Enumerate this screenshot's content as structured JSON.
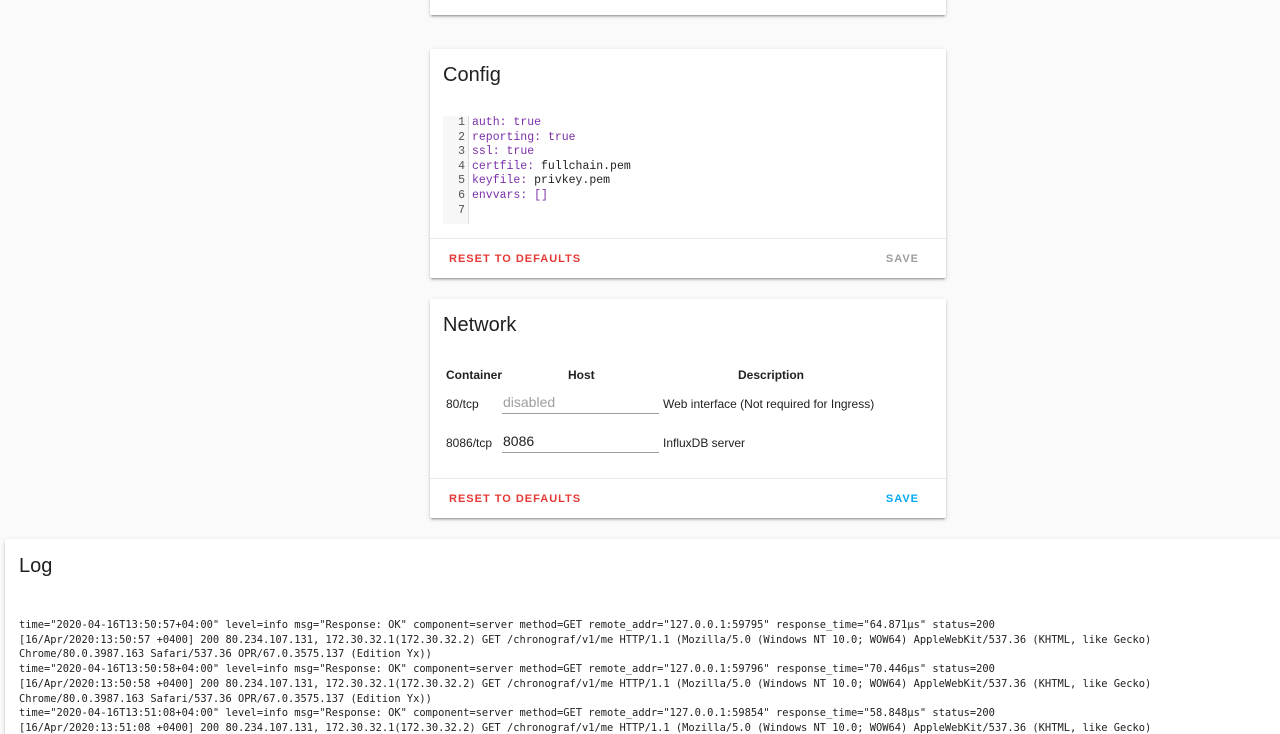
{
  "config": {
    "title": "Config",
    "line_numbers": [
      "1",
      "2",
      "3",
      "4",
      "5",
      "6",
      "7"
    ],
    "lines": [
      {
        "key": "auth",
        "value": "true",
        "bool": true
      },
      {
        "key": "reporting",
        "value": "true",
        "bool": true
      },
      {
        "key": "ssl",
        "value": "true",
        "bool": true
      },
      {
        "key": "certfile",
        "value": "fullchain.pem",
        "bool": false
      },
      {
        "key": "keyfile",
        "value": "privkey.pem",
        "bool": false
      },
      {
        "key": "envvars",
        "value": "[]",
        "bool": true
      },
      {
        "key": "",
        "value": "",
        "bool": false
      }
    ],
    "reset_label": "RESET TO DEFAULTS",
    "save_label": "SAVE"
  },
  "network": {
    "title": "Network",
    "headers": {
      "container": "Container",
      "host": "Host",
      "description": "Description"
    },
    "rows": [
      {
        "container": "80/tcp",
        "host_value": "",
        "host_placeholder": "disabled",
        "description": "Web interface (Not required for Ingress)"
      },
      {
        "container": "8086/tcp",
        "host_value": "8086",
        "host_placeholder": "",
        "description": "InfluxDB server"
      }
    ],
    "reset_label": "RESET TO DEFAULTS",
    "save_label": "SAVE"
  },
  "log": {
    "title": "Log",
    "lines": [
      "time=\"2020-04-16T13:50:57+04:00\" level=info msg=\"Response: OK\" component=server method=GET remote_addr=\"127.0.0.1:59795\" response_time=\"64.871µs\" status=200",
      "[16/Apr/2020:13:50:57 +0400] 200 80.234.107.131, 172.30.32.1(172.30.32.2) GET /chronograf/v1/me HTTP/1.1 (Mozilla/5.0 (Windows NT 10.0; WOW64) AppleWebKit/537.36 (KHTML, like Gecko)",
      "Chrome/80.0.3987.163 Safari/537.36 OPR/67.0.3575.137 (Edition Yx))",
      "time=\"2020-04-16T13:50:58+04:00\" level=info msg=\"Response: OK\" component=server method=GET remote_addr=\"127.0.0.1:59796\" response_time=\"70.446µs\" status=200",
      "[16/Apr/2020:13:50:58 +0400] 200 80.234.107.131, 172.30.32.1(172.30.32.2) GET /chronograf/v1/me HTTP/1.1 (Mozilla/5.0 (Windows NT 10.0; WOW64) AppleWebKit/537.36 (KHTML, like Gecko)",
      "Chrome/80.0.3987.163 Safari/537.36 OPR/67.0.3575.137 (Edition Yx))",
      "time=\"2020-04-16T13:51:08+04:00\" level=info msg=\"Response: OK\" component=server method=GET remote_addr=\"127.0.0.1:59854\" response_time=\"58.848µs\" status=200",
      "[16/Apr/2020:13:51:08 +0400] 200 80.234.107.131, 172.30.32.1(172.30.32.2) GET /chronograf/v1/me HTTP/1.1 (Mozilla/5.0 (Windows NT 10.0; WOW64) AppleWebKit/537.36 (KHTML, like Gecko)"
    ]
  }
}
